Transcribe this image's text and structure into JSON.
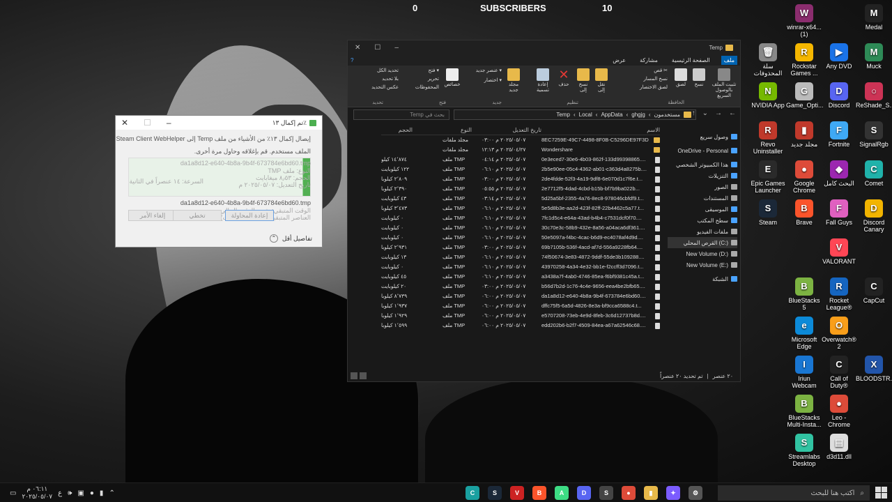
{
  "overlay": {
    "left_value": "0",
    "title": "SUBSCRIBERS",
    "right_value": "10"
  },
  "desktop_icons": [
    {
      "label": "winrar-x64...\n(1)",
      "color": "#8b2d6e",
      "glyph": "W"
    },
    {
      "label": "Medal",
      "color": "#222222",
      "glyph": "M"
    },
    {
      "label": "سلة المحذوفات",
      "color": "#888888",
      "glyph": "🗑"
    },
    {
      "label": "Rockstar Games ...",
      "color": "#f5b700",
      "glyph": "R"
    },
    {
      "label": "Any DVD",
      "color": "#1a73e8",
      "glyph": "▶"
    },
    {
      "label": "Muck",
      "color": "#2e8b57",
      "glyph": "M"
    },
    {
      "label": "NVIDIA App",
      "color": "#76b900",
      "glyph": "N"
    },
    {
      "label": "Game_Opti...",
      "color": "#bbbbbb",
      "glyph": "G"
    },
    {
      "label": "Discord",
      "color": "#5865f2",
      "glyph": "D"
    },
    {
      "label": "ReShade_S...",
      "color": "#cc3355",
      "glyph": "○"
    },
    {
      "label": "Revo Uninstaller",
      "color": "#c0392b",
      "glyph": "R"
    },
    {
      "label": "مجلد جديد",
      "color": "#c0392b",
      "glyph": "▮"
    },
    {
      "label": "Fortnite",
      "color": "#3fa9f5",
      "glyph": "F"
    },
    {
      "label": "SignalRgb",
      "color": "#333333",
      "glyph": "S"
    },
    {
      "label": "Epic Games Launcher",
      "color": "#2a2a2a",
      "glyph": "E"
    },
    {
      "label": "Google Chrome",
      "color": "#dd4b39",
      "glyph": "●"
    },
    {
      "label": "البحث كامل",
      "color": "#9c27b0",
      "glyph": "◆"
    },
    {
      "label": "Comet",
      "color": "#20b2aa",
      "glyph": "C"
    },
    {
      "label": "Steam",
      "color": "#1b2838",
      "glyph": "S"
    },
    {
      "label": "Brave",
      "color": "#fb542b",
      "glyph": "B"
    },
    {
      "label": "Fall Guys",
      "color": "#e060c0",
      "glyph": "F"
    },
    {
      "label": "Discord Canary",
      "color": "#f2b400",
      "glyph": "D"
    },
    {
      "label": "VALORANT",
      "color": "#ff4655",
      "glyph": "V"
    },
    {
      "label": "BlueStacks 5",
      "color": "#7cb342",
      "glyph": "B"
    },
    {
      "label": "Rocket League®",
      "color": "#1565c0",
      "glyph": "R"
    },
    {
      "label": "CapCut",
      "color": "#222222",
      "glyph": "C"
    },
    {
      "label": "Microsoft Edge",
      "color": "#0c8ad8",
      "glyph": "e"
    },
    {
      "label": "Overwatch® 2",
      "color": "#f99e1a",
      "glyph": "O"
    },
    {
      "label": "Iriun Webcam",
      "color": "#1976d2",
      "glyph": "I"
    },
    {
      "label": "Call of Duty®",
      "color": "#222222",
      "glyph": "C"
    },
    {
      "label": "BLOODSTR...",
      "color": "#2255aa",
      "glyph": "X"
    },
    {
      "label": "BlueStacks Multi-Insta...",
      "color": "#7cb342",
      "glyph": "B"
    },
    {
      "label": "Leo - Chrome",
      "color": "#dd4b39",
      "glyph": "●"
    },
    {
      "label": "Streamlabs Desktop",
      "color": "#31c3a2",
      "glyph": "S"
    },
    {
      "label": "d3d11.dll",
      "color": "#dddddd",
      "glyph": "▤"
    }
  ],
  "dialog": {
    "title": "تم إكمال ١٣٪",
    "line1": "إيصال إكمال ١٣٪ من الأشياء من ملف Temp إلى Steam Client WebHelper",
    "line2": "الملف مستخدم. قم بإغلاقه وحاول مرة أخرى.",
    "ghost_line": "da1a8d12-e640-4b8a-9b4f-673784e6bd60.tmp",
    "type_line": "النوع: ملف TMP",
    "size_line": "الحجم: ٨٫٥٣ ميغابايت",
    "date_line": "تاريخ التعديل: ٢٠٢٥/٠٥/٠٧ م",
    "speed_line": "السرعة: ١٤ عنصراً في الثانية",
    "file_line": "da1a8d12-e640-4b8a-9b4f-673784e6bd60.tmp",
    "remaining_line": "الوقت المتبقي: تقدير الوقت الحالي",
    "items_line": "العناصر المتبقية: ٧٧ (٢٧٣ ميغابايت)",
    "cancel_label": "إلغاء الأمر",
    "skip_label": "تخطي",
    "retry_label": "إعادة المحاولة",
    "less_details": "تفاصيل أقل"
  },
  "explorer": {
    "title": "Temp",
    "tabs": [
      "ملف",
      "الصفحة الرئيسية",
      "مشاركة",
      "عرض"
    ],
    "ribbon": {
      "pin_quick": "تثبيت الملف بالوصول السريع",
      "copy": "نسخ",
      "paste": "لصق",
      "cut": "قص",
      "copy_path": "نسخ المسار",
      "paste_shortcut": "لصق الاختصار",
      "group_clipboard": "الحافظة",
      "move_to": "نقل إلى",
      "copy_to": "نسخ إلى",
      "delete": "حذف",
      "rename": "إعادة تسمية",
      "group_organize": "تنظيم",
      "new_folder": "مجلد جديد",
      "new_item": "عنصر جديد",
      "easy_access": "اختصار",
      "group_new": "جديد",
      "properties": "خصائص",
      "open": "فتح",
      "edit": "تحرير",
      "history": "المحفوظات",
      "group_open": "فتح",
      "select_all": "تحديد الكل",
      "select_none": "بلا تحديد",
      "invert_selection": "عكس التحديد",
      "group_select": "تحديد"
    },
    "search_placeholder": "بحث في Temp",
    "path": [
      "مستخدمون",
      "ghgjg",
      "AppData",
      "Local",
      "Temp"
    ],
    "nav_pane": [
      {
        "label": "وصول سريع",
        "color": "#4aa3ff"
      },
      {
        "label": "OneDrive - Personal",
        "color": "#4aa3ff"
      },
      {
        "label": "هذا الكمبيوتر الشخصي",
        "color": "#4aa3ff"
      },
      {
        "label": "التنزيلات",
        "color": "#4aa3ff"
      },
      {
        "label": "الصور",
        "color": "#aaaaaa"
      },
      {
        "label": "المستندات",
        "color": "#aaaaaa"
      },
      {
        "label": "الموسيقى",
        "color": "#4aa3ff"
      },
      {
        "label": "سطح المكتب",
        "color": "#4aa3ff"
      },
      {
        "label": "ملفات الفيديو",
        "color": "#aaaaaa"
      },
      {
        "label": "القرص المحلي (C:)",
        "color": "#aaaaaa"
      },
      {
        "label": "New Volume (D:)",
        "color": "#aaaaaa"
      },
      {
        "label": "New Volume (E:)",
        "color": "#aaaaaa"
      },
      {
        "label": "الشبكة",
        "color": "#4aa3ff"
      }
    ],
    "columns": {
      "name": "الاسم",
      "date": "تاريخ التعديل",
      "type": "النوع",
      "size": "الحجم"
    },
    "files": [
      {
        "name": "8EC7259E-49C7-4498-8F0B-C5296DE97F3D",
        "date": "٢٠٢٥/٠٥/٠٧ م ٠٣:٠٠",
        "type": "مجلد ملفات",
        "size": "",
        "folder": true
      },
      {
        "name": "Wondershare",
        "date": "٢٠٢٥/٠٤/٢٧ م ١٢:١٣",
        "type": "مجلد ملفات",
        "size": "",
        "folder": true
      },
      {
        "name": "0e3eced7-30e6-4b03-862f-133d99398865....",
        "date": "٢٠٢٥/٠٥/٠٧ م ٠٤:١٤",
        "type": "ملف TMP",
        "size": "١٤٬٨٧٤ كيلو"
      },
      {
        "name": "2b5e90ee-05c4-4362-ab01-c363d4a8275b....",
        "date": "٢٠٢٥/٠٥/٠٧ م ٠٦:١٠",
        "type": "ملف TMP",
        "size": "١٢٢ كيلوبايت"
      },
      {
        "name": "2de4fdde-52f3-4a19-9df8-6e070d1c7f6e.t...",
        "date": "٢٠٢٥/٠٥/٠٧ م ٠٣:٠٠",
        "type": "ملف TMP",
        "size": "٢٬٨٠٩ كيلوبا"
      },
      {
        "name": "2e7712f5-4dad-4cbd-b15b-bf7b9ba022b...",
        "date": "٢٠٢٥/٠٥/٠٧ م ٠٥:٥٥",
        "type": "ملف TMP",
        "size": "٢٬٣٩٠ كيلوبا"
      },
      {
        "name": "5d25a5bf-2355-4a76-8ec8-978046cbfdf9.t...",
        "date": "٢٠٢٥/٠٥/٠٧ م ٠٣:١٤",
        "type": "ملف TMP",
        "size": "٤٣ كيلوبايت"
      },
      {
        "name": "5e5d8b3e-aa2d-423f-82ff-22b4462c5a77.t...",
        "date": "٢٠٢٥/٠٥/٠٧ م ٠٦:١٠",
        "type": "ملف TMP",
        "size": "٣٬٤٧٣ كيلوبا"
      },
      {
        "name": "7fc1d5c4-e64a-43ad-b4b4-c7531dcf0f70....",
        "date": "٢٠٢٥/٠٥/٠٧ م ٠٦:١٠",
        "type": "ملف TMP",
        "size": "٠ كيلوبايت"
      },
      {
        "name": "30c70e3c-58b9-432e-8a56-a04aca6df361....",
        "date": "٢٠٢٥/٠٥/٠٧ م ٠٦:١٠",
        "type": "ملف TMP",
        "size": "٠ كيلوبايت"
      },
      {
        "name": "50e5097a-f4bc-4cac-b6d9-ec4078af4d9d....",
        "date": "٢٠٢٥/٠٥/٠٧ م ٠٦:١٠",
        "type": "ملف TMP",
        "size": "٠ كيلوبايت"
      },
      {
        "name": "69b7105b-536f-4acd-af7d-556a9228fb64....",
        "date": "٢٠٢٥/٠٥/٠٧ م ٠٣:٠٠",
        "type": "ملف TMP",
        "size": "٢٬٩٣١ كيلوبا"
      },
      {
        "name": "74f50674-3e83-4872-9ddf-55de3b109288....",
        "date": "٢٠٢٥/٠٥/٠٧ م ٠٦:١٠",
        "type": "ملف TMP",
        "size": "١٣ كيلوبايت"
      },
      {
        "name": "43970258-4a34-4e32-bb1e-f2ccff3d7096.t...",
        "date": "٢٠٢٥/٠٥/٠٧ م ٠٦:١٠",
        "type": "ملف TMP",
        "size": "٠ كيلوبايت"
      },
      {
        "name": "a3438a7f-4ab0-4746-85ea-f6bf9381c45a.t...",
        "date": "٢٠٢٥/٠٥/٠٧ م ٠٦:١٠",
        "type": "ملف TMP",
        "size": "٤٥ كيلوبايت"
      },
      {
        "name": "b56d7b2d-1c76-4c4e-9656-eea4be2bfb65....",
        "date": "٢٠٢٥/٠٥/٠٧ م ٠٣:٠٠",
        "type": "ملف TMP",
        "size": "٢٠ كيلوبايت"
      },
      {
        "name": "da1a8d12-e640-4b8a-9b4f-673784e6bd60....",
        "date": "٢٠٢٥/٠٥/٠٧ م ٠٦:٠٠",
        "type": "ملف TMP",
        "size": "٨٬٧٣٩ كيلوبا"
      },
      {
        "name": "dffc75f5-6a5d-4826-8e3a-bf9cca6588c4.t...",
        "date": "٢٠٢٥/٠٥/٠٧ م ٠٦:٠٠",
        "type": "ملف TMP",
        "size": "١٬٩٣٧ كيلوبا"
      },
      {
        "name": "e5707208-73eb-4e9d-8feb-3c6d12737b8d....",
        "date": "٢٠٢٥/٠٥/٠٧ م ٠٦:٠٠",
        "type": "ملف TMP",
        "size": "١٬٩٢٩ كيلوبا"
      },
      {
        "name": "edd202b6-b2f7-4509-84ea-a67a62546c68....",
        "date": "٢٠٢٥/٠٥/٠٧ م ٠٦:٠٠",
        "type": "ملف TMP",
        "size": "١٬٥٩٩ كيلوبا"
      }
    ],
    "status_items": "٢٠ عنصر",
    "status_selected": "تم تحديد ٢٠ عنصراً"
  },
  "taskbar": {
    "search_placeholder": "اكتب هنا للبحث",
    "time": "٠٦:١١ م",
    "date": "٢٠٢٥/٠٥/٠٧",
    "lang": "ع",
    "apps": [
      {
        "name": "copilot",
        "color": "#1aa0a0",
        "glyph": "C"
      },
      {
        "name": "steam",
        "color": "#1b2838",
        "glyph": "S"
      },
      {
        "name": "voice-meeter",
        "color": "#cc2222",
        "glyph": "V"
      },
      {
        "name": "brave",
        "color": "#fb542b",
        "glyph": "B"
      },
      {
        "name": "android",
        "color": "#3ddc84",
        "glyph": "A"
      },
      {
        "name": "discord",
        "color": "#5865f2",
        "glyph": "D"
      },
      {
        "name": "store",
        "color": "#444444",
        "glyph": "S"
      },
      {
        "name": "chrome",
        "color": "#dd4b39",
        "glyph": "●"
      },
      {
        "name": "explorer",
        "color": "#e8b94a",
        "glyph": "▮"
      },
      {
        "name": "copilot-app",
        "color": "#7b5cff",
        "glyph": "✦"
      },
      {
        "name": "settings",
        "color": "#555555",
        "glyph": "⚙"
      }
    ]
  }
}
